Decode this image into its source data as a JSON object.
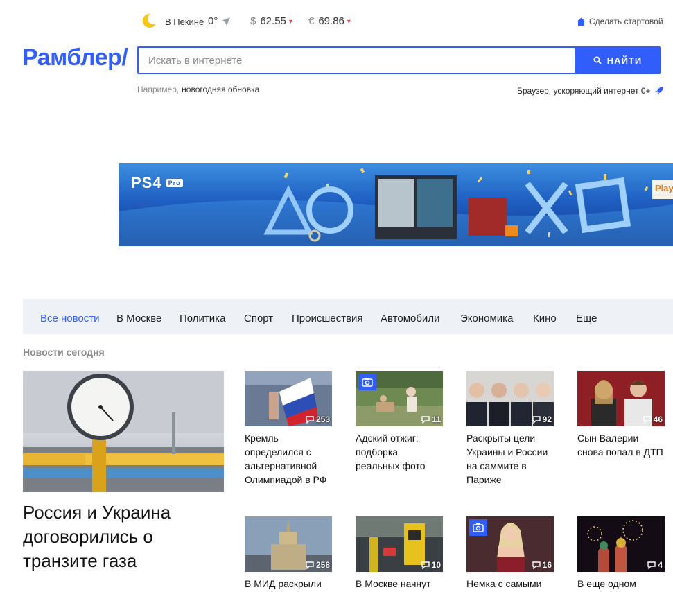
{
  "topbar": {
    "weather_city": "В Пекине",
    "weather_temp": "0°",
    "usd_symbol": "$",
    "usd_value": "62.55",
    "eur_symbol": "€",
    "eur_value": "69.86",
    "make_start": "Сделать стартовой"
  },
  "logo": "Рамблер/",
  "search": {
    "placeholder": "Искать в интернете",
    "button_label": "НАЙТИ",
    "example_prefix": "Например,",
    "example_link": "новогодняя обновка"
  },
  "browser_promo": "Браузер, ускоряющий интернет 0+",
  "banner": {
    "brand": "PS4",
    "badge": "Pro",
    "tag": "Play"
  },
  "nav": {
    "items": [
      "Все новости",
      "В Москве",
      "Политика",
      "Спорт",
      "Происшествия",
      "Автомобили",
      "Экономика",
      "Кино",
      "Еще"
    ]
  },
  "section_title": "Новости сегодня",
  "main_story": {
    "title": "Россия и Украина договорились о транзите газа"
  },
  "cards": [
    {
      "title": "Кремль определился с альтернативной Олимпиадой в РФ",
      "comments": "253",
      "photo": false
    },
    {
      "title": "Адский отжиг: подборка реальных фото",
      "comments": "11",
      "photo": true
    },
    {
      "title": "Раскрыты цели Украины и России на саммите в Париже",
      "comments": "92",
      "photo": false
    },
    {
      "title": "Сын Валерии снова попал в ДТП",
      "comments": "46",
      "photo": false
    },
    {
      "title": "В МИД раскрыли",
      "comments": "258",
      "photo": false
    },
    {
      "title": "В Москве начнут",
      "comments": "10",
      "photo": false
    },
    {
      "title": "Немка с самыми",
      "comments": "16",
      "photo": true
    },
    {
      "title": "В еще одном",
      "comments": "4",
      "photo": false
    }
  ],
  "colors": {
    "accent": "#315efb",
    "caret": "#e5393f",
    "nav_bg": "#eef1f5"
  }
}
